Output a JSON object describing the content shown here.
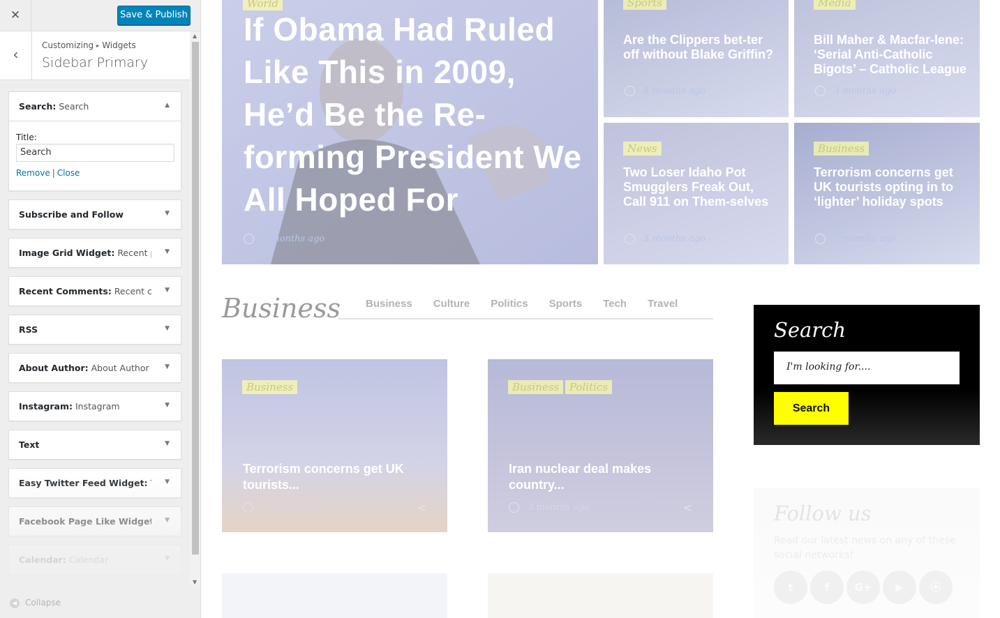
{
  "customizer": {
    "close_icon_glyph": "✕",
    "publish_label": "Save & Publish",
    "back_glyph": "‹",
    "breadcrumb": {
      "root": "Customizing",
      "sep": "▸",
      "leaf": "Widgets"
    },
    "section_title": "Sidebar Primary",
    "open_widget": {
      "name": "Search:",
      "inside": "Search",
      "title_label": "Title:",
      "title_value": "Search",
      "remove_label": "Remove",
      "pipe": "|",
      "close_label": "Close"
    },
    "widgets": [
      {
        "name": "Subscribe and Follow",
        "inside": ""
      },
      {
        "name": "Image Grid Widget:",
        "inside": "Recent po..."
      },
      {
        "name": "Recent Comments:",
        "inside": "Recent co..."
      },
      {
        "name": "RSS",
        "inside": ""
      },
      {
        "name": "About Author:",
        "inside": "About Author"
      },
      {
        "name": "Instagram:",
        "inside": "Instagram"
      },
      {
        "name": "Text",
        "inside": ""
      },
      {
        "name": "Easy Twitter Feed Widget:",
        "inside": "Twi..."
      },
      {
        "name": "Facebook Page Like Widget:",
        "inside": "L..."
      },
      {
        "name": "Calendar:",
        "inside": "Calendar"
      }
    ],
    "collapse_label": "Collapse"
  },
  "preview": {
    "hero_main": {
      "category": "World",
      "title": "If Obama Had Ruled Like This in 2009, He’d Be the Re-forming President We All Hoped For",
      "time": "3 months ago"
    },
    "hero_small": [
      {
        "category": "Sports",
        "title": "Are the Clippers bet-ter off without Blake Griffin?",
        "time": "4 months ago"
      },
      {
        "category": "Media",
        "title": "Bill Maher & Macfar-lene: ‘Serial Anti-Catholic Bigots’ – Catholic League",
        "time": "3 months ago"
      },
      {
        "category": "News",
        "title": "Two Loser Idaho Pot Smugglers Freak Out, Call 911 on Them-selves",
        "time": "3 months ago"
      },
      {
        "category": "Business",
        "title": "Terrorism concerns get UK tourists opting in to ‘lighter’ holiday spots",
        "time": "3 months ago"
      }
    ],
    "section": {
      "heading": "Business",
      "tabs": [
        "Business",
        "Culture",
        "Politics",
        "Sports",
        "Tech",
        "Travel"
      ]
    },
    "cards": [
      {
        "categories": [
          "Business"
        ],
        "title": "Terrorism concerns get UK tourists...",
        "time": "3 months ago"
      },
      {
        "categories": [
          "Business",
          "Politics"
        ],
        "title": "Iran nuclear deal makes country...",
        "time": "3 months ago"
      }
    ],
    "search_widget": {
      "title": "Search",
      "placeholder": "I'm looking for....",
      "button": "Search"
    },
    "follow_widget": {
      "title": "Follow us",
      "text": "Read our latest news on any of these social networks!",
      "icons": [
        "twitter-icon",
        "facebook-icon",
        "google-plus-icon",
        "youtube-icon",
        "rss-icon"
      ],
      "glyphs": [
        "t",
        "f",
        "G+",
        "▶",
        "⦿"
      ]
    },
    "colors": {
      "accent": "#ffff00",
      "publish": "#0085ba",
      "link": "#0073aa"
    }
  }
}
